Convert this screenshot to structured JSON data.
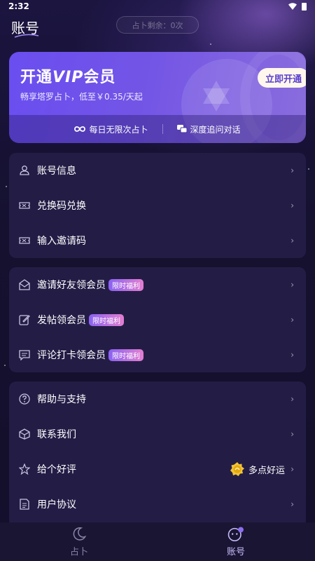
{
  "status": {
    "time": "2:32"
  },
  "header": {
    "title": "账号",
    "counter": "占卜剩余：0次"
  },
  "vip": {
    "title_prefix": "开通",
    "title_vip": "VIP",
    "title_suffix": "会员",
    "subtitle": "畅享塔罗占卜，低至￥0.35/天起",
    "open_button": "立即开通",
    "perks": [
      {
        "icon": "infinity-icon",
        "label": "每日无限次占卜"
      },
      {
        "icon": "chat-icon",
        "label": "深度追问对话"
      }
    ]
  },
  "panel1": {
    "items": [
      {
        "icon": "user-icon",
        "label": "账号信息"
      },
      {
        "icon": "ticket-icon",
        "label": "兑换码兑换"
      },
      {
        "icon": "ticket-icon",
        "label": "输入邀请码"
      }
    ]
  },
  "panel2": {
    "badge": "限时福利",
    "items": [
      {
        "icon": "mail-icon",
        "label": "邀请好友领会员"
      },
      {
        "icon": "edit-icon",
        "label": "发帖领会员"
      },
      {
        "icon": "comment-icon",
        "label": "评论打卡领会员"
      }
    ]
  },
  "panel3": {
    "items": [
      {
        "icon": "help-icon",
        "label": "帮助与支持"
      },
      {
        "icon": "box-icon",
        "label": "联系我们"
      },
      {
        "icon": "star-icon",
        "label": "给个好评",
        "extra": "多点好运"
      },
      {
        "icon": "document-icon",
        "label": "用户协议"
      }
    ]
  },
  "chevron": "›",
  "tabs": [
    {
      "icon": "moon-icon",
      "label": "占卜",
      "active": false
    },
    {
      "icon": "face-icon",
      "label": "账号",
      "active": true
    }
  ],
  "colors": {
    "accent": "#7355e6",
    "panel": "#231d46",
    "tab_active": "#c6bdf7",
    "tab_inactive": "#8a84a8"
  }
}
